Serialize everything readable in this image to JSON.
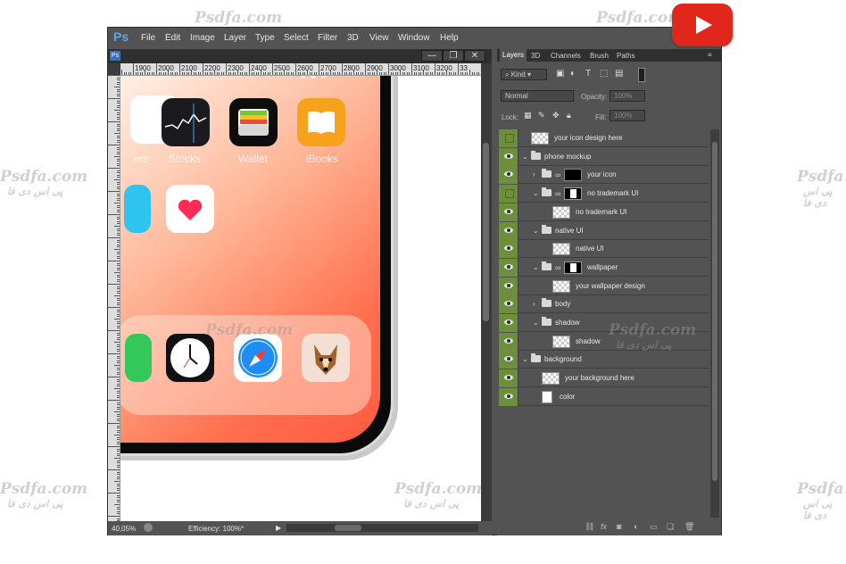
{
  "app": {
    "logo": "Ps",
    "menu": [
      "File",
      "Edit",
      "Image",
      "Layer",
      "Type",
      "Select",
      "Filter",
      "3D",
      "View",
      "Window",
      "Help"
    ]
  },
  "document": {
    "tab_icon": "Ps",
    "window_buttons": [
      "—",
      "❐",
      "✕"
    ],
    "ruler_labels": [
      "10",
      "1900",
      "2000",
      "2100",
      "2200",
      "2300",
      "2400",
      "2500",
      "2600",
      "2700",
      "2800",
      "2900",
      "3000",
      "3100",
      "3200",
      "33"
    ],
    "zoom": "40,05%",
    "status": "Efficiency: 100%*"
  },
  "phone": {
    "labels": [
      "ers",
      "Stocks",
      "Wallet",
      "iBooks"
    ],
    "colors": {
      "stocks": "#1b1b1f",
      "wallet": "#111",
      "ibooks": "#f7a21b",
      "health": "#ffffff",
      "safari": "#ffffff",
      "clock": "#111111",
      "dog": "#f3dfd3",
      "maps": "#2ec4ef",
      "phone": "#34c759"
    }
  },
  "panel": {
    "tabs": [
      "Layers",
      "3D",
      "Channels",
      "Brush",
      "Paths"
    ],
    "filter_kind": "Kind",
    "blend_mode": "Normal",
    "opacity_label": "Opacity:",
    "opacity_value": "100%",
    "lock_label": "Lock:",
    "fill_label": "Fill:",
    "fill_value": "100%",
    "layers": [
      {
        "name": "your icon design here",
        "visible": false,
        "indent": 0,
        "type": "smart"
      },
      {
        "name": "phone mockup",
        "visible": true,
        "indent": 0,
        "type": "group",
        "open": true
      },
      {
        "name": "your icon",
        "visible": true,
        "indent": 1,
        "type": "group-mask",
        "open": false
      },
      {
        "name": "no trademark UI",
        "visible": false,
        "indent": 1,
        "type": "group-mask",
        "open": true
      },
      {
        "name": "no trademark UI",
        "visible": true,
        "indent": 2,
        "type": "smart"
      },
      {
        "name": "native UI",
        "visible": true,
        "indent": 1,
        "type": "group",
        "open": true
      },
      {
        "name": "native UI",
        "visible": true,
        "indent": 2,
        "type": "smart"
      },
      {
        "name": "wallpaper",
        "visible": true,
        "indent": 1,
        "type": "group-mask",
        "open": true
      },
      {
        "name": "your wallpaper design",
        "visible": true,
        "indent": 2,
        "type": "smart"
      },
      {
        "name": "body",
        "visible": true,
        "indent": 1,
        "type": "group",
        "open": false
      },
      {
        "name": "shadow",
        "visible": true,
        "indent": 1,
        "type": "group",
        "open": true
      },
      {
        "name": "shadow",
        "visible": true,
        "indent": 2,
        "type": "layer"
      },
      {
        "name": "background",
        "visible": true,
        "indent": 0,
        "type": "group",
        "open": true
      },
      {
        "name": "your background here",
        "visible": true,
        "indent": 1,
        "type": "layer"
      },
      {
        "name": "color",
        "visible": true,
        "indent": 1,
        "type": "white"
      }
    ],
    "footer_icons": [
      "link-icon",
      "fx-icon",
      "mask-icon",
      "adjustment-icon",
      "folder-icon",
      "new-layer-icon",
      "trash-icon"
    ]
  },
  "watermark": "Psdfa.com",
  "watermark_sub": "پی اس دی فا",
  "colors": {
    "eye_green": "#6f8e3c",
    "ps_blue": "#5aa7e6",
    "youtube_red": "#e1261c"
  }
}
